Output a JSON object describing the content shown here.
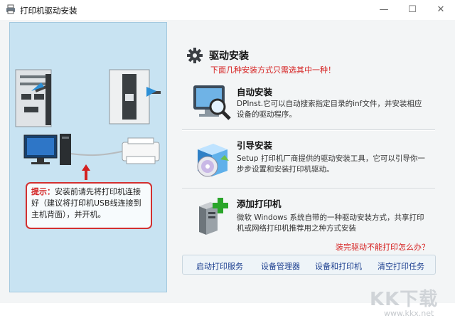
{
  "window": {
    "title": "打印机驱动安装",
    "min_glyph": "—",
    "max_glyph": "☐",
    "close_glyph": "✕"
  },
  "left_panel": {
    "tip_label": "提示：",
    "tip_text": "安装前请先将打印机连接好（建议将打印机USB线连接到主机背面），并开机。"
  },
  "main": {
    "title": "驱动安装",
    "subtitle": "下面几种安装方式只需选其中一种！",
    "options": [
      {
        "title": "自动安装",
        "desc": "DPInst.它可以自动搜索指定目录的inf文件，并安装相应设备的驱动程序。",
        "icon": "monitor-magnifier-icon"
      },
      {
        "title": "引导安装",
        "desc": "Setup 打印机厂商提供的驱动安装工具，它可以引导你一步步设置和安装打印机驱动。",
        "icon": "setup-box-cd-icon"
      },
      {
        "title": "添加打印机",
        "desc": "微软 Windows 系统自带的一种驱动安装方式，共享打印机或网络打印机推荐用之种方式安装",
        "icon": "computer-add-icon"
      }
    ],
    "help_link": "装完驱动不能打印怎么办？"
  },
  "bottom_bar": {
    "links": [
      "启动打印服务",
      "设备管理器",
      "设备和打印机",
      "清空打印任务"
    ]
  },
  "watermark": {
    "logo": "KK下载",
    "url": "www.kkx.net"
  },
  "colors": {
    "panel_bg": "#c8e3f2",
    "accent_red": "#d62020",
    "link_blue": "#1b3e8f"
  }
}
